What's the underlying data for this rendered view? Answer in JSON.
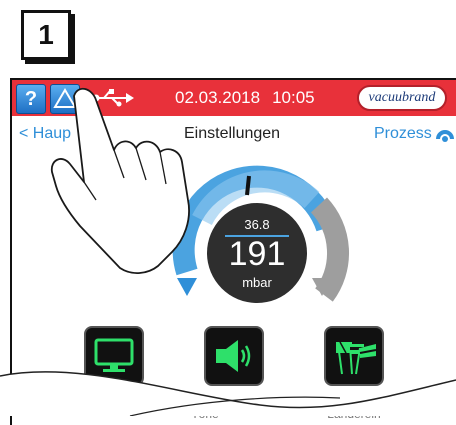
{
  "step": {
    "number": "1"
  },
  "topbar": {
    "help_label": "?",
    "date": "02.03.2018",
    "time": "10:05",
    "brand": "vacuubrand",
    "icons": [
      "help-icon",
      "warning-icon",
      "usb-icon"
    ],
    "color": "#e8313a"
  },
  "nav": {
    "back_label": "< Haup",
    "title": "Einstellungen",
    "process_label": "Prozess",
    "accent": "#2f8fd8"
  },
  "gauge": {
    "setpoint": "36.8",
    "value": "191",
    "unit": "mbar"
  },
  "tiles": [
    {
      "name": "display",
      "icon": "monitor-icon",
      "label": ""
    },
    {
      "name": "sound",
      "icon": "speaker-icon",
      "label": "Töne"
    },
    {
      "name": "country",
      "icon": "flags-icon",
      "label": "Länderein"
    }
  ]
}
